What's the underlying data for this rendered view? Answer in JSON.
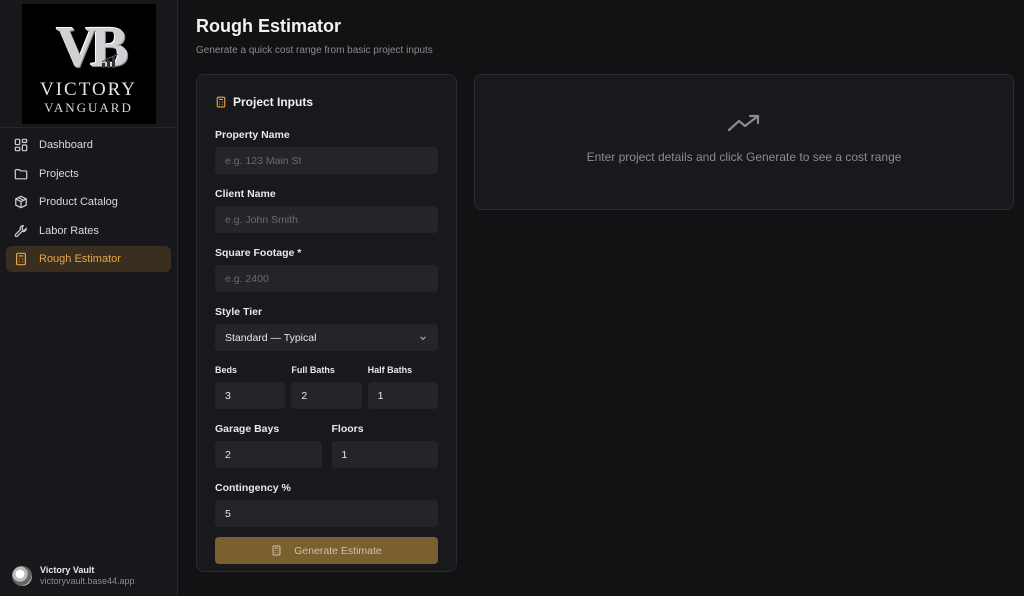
{
  "brand": {
    "line1": "VICTORY",
    "line2": "VANGUARD",
    "mono": "VB"
  },
  "sidebar": {
    "items": [
      {
        "label": "Dashboard",
        "icon": "dashboard-icon"
      },
      {
        "label": "Projects",
        "icon": "folder-icon"
      },
      {
        "label": "Product Catalog",
        "icon": "package-icon"
      },
      {
        "label": "Labor Rates",
        "icon": "wrench-icon"
      },
      {
        "label": "Rough Estimator",
        "icon": "calculator-icon",
        "active": true
      }
    ],
    "footer": {
      "name": "Victory Vault",
      "url": "victoryvault.base44.app"
    }
  },
  "page": {
    "title": "Rough Estimator",
    "subtitle": "Generate a quick cost range from basic project inputs"
  },
  "form": {
    "title": "Project Inputs",
    "property_name": {
      "label": "Property Name",
      "placeholder": "e.g. 123 Main St",
      "value": ""
    },
    "client_name": {
      "label": "Client Name",
      "placeholder": "e.g. John Smith",
      "value": ""
    },
    "square_footage": {
      "label": "Square Footage *",
      "placeholder": "e.g. 2400",
      "value": ""
    },
    "style_tier": {
      "label": "Style Tier",
      "value": "Standard — Typical"
    },
    "beds": {
      "label": "Beds",
      "value": "3"
    },
    "full_baths": {
      "label": "Full Baths",
      "value": "2"
    },
    "half_baths": {
      "label": "Half Baths",
      "value": "1"
    },
    "garage_bays": {
      "label": "Garage Bays",
      "value": "2"
    },
    "floors": {
      "label": "Floors",
      "value": "1"
    },
    "contingency": {
      "label": "Contingency %",
      "value": "5"
    },
    "generate_label": "Generate Estimate"
  },
  "result": {
    "empty_text": "Enter project details and click Generate to see a cost range"
  },
  "colors": {
    "accent": "#e6a449",
    "button": "#7a5f2f",
    "background": "#111214"
  }
}
